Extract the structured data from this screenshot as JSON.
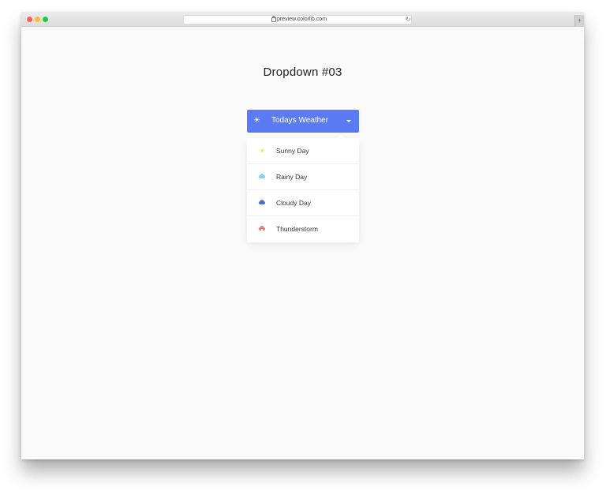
{
  "browser": {
    "url": "preview.colorlib.com",
    "new_tab": "+"
  },
  "page": {
    "title": "Dropdown #03"
  },
  "dropdown": {
    "toggle_label": "Todays Weather",
    "toggle_icon": "sun-icon",
    "accent_color": "#5b7bf4",
    "items": [
      {
        "label": "Sunny Day",
        "icon": "sun-icon",
        "color": "#f5d66a"
      },
      {
        "label": "Rainy Day",
        "icon": "rain-cloud-icon",
        "color": "#7fd3ec"
      },
      {
        "label": "Cloudy Day",
        "icon": "cloud-icon",
        "color": "#4c70c9"
      },
      {
        "label": "Thunderstorm",
        "icon": "thunderstorm-icon",
        "color": "#e97b7b"
      }
    ]
  }
}
